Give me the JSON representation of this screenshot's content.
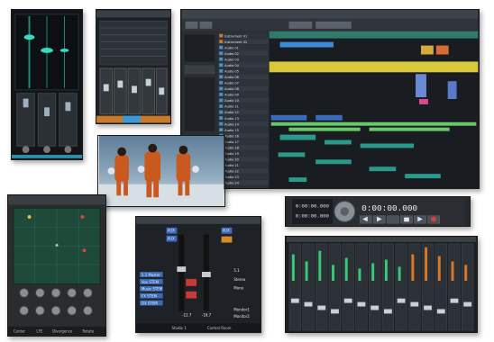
{
  "colors": {
    "daw_bg": "#1c1f24",
    "track_blue": "#4a90c8",
    "yellow_band": "#d8c83a",
    "teal_clip": "#2a9a8a",
    "green_clip": "#6ac86a",
    "surround_grid": "#1e4a3a",
    "mixer_strip": "#3a3f45"
  },
  "project_window": {
    "tracks": [
      "Instrument 01",
      "Instrument 02",
      "Audio 01",
      "Audio 02",
      "Audio 03",
      "Audio 04",
      "Audio 05",
      "Audio 06",
      "Audio 07",
      "Audio 08",
      "Audio 09",
      "Audio 10",
      "Audio 11",
      "Audio 12",
      "Audio 13",
      "Audio 14",
      "Audio 15",
      "Audio 16",
      "Audio 17",
      "Audio 18",
      "Audio 19",
      "Audio 20",
      "Audio 21",
      "Audio 22",
      "Audio 23",
      "Audio 24"
    ]
  },
  "transport": {
    "time_primary": "0:00:00.000",
    "time_secondary_top": "0:00:00.000",
    "time_secondary_bottom": "0:00:00.000"
  },
  "control_room": {
    "top_labels": [
      "AUX",
      "AUX",
      "AUX"
    ],
    "left_labels": [
      "5.1 Master",
      "Vox STEM",
      "Music STEM",
      "FX STEM",
      "DX STEM"
    ],
    "right_labels": [
      "5.1",
      "Stereo",
      "Mono"
    ],
    "monitor_labels": [
      "Monitor1",
      "Monitor2"
    ],
    "footer_left": "Studio 1",
    "footer_right": "Control Room",
    "fader_value_left": "-12.7",
    "fader_value_right": "-16.7"
  },
  "surround_panner": {
    "bottom_labels": [
      "Center",
      "LFE",
      "Divergence",
      "Rotate"
    ]
  },
  "video_frame": {
    "description_icon": "astronauts-photo"
  }
}
